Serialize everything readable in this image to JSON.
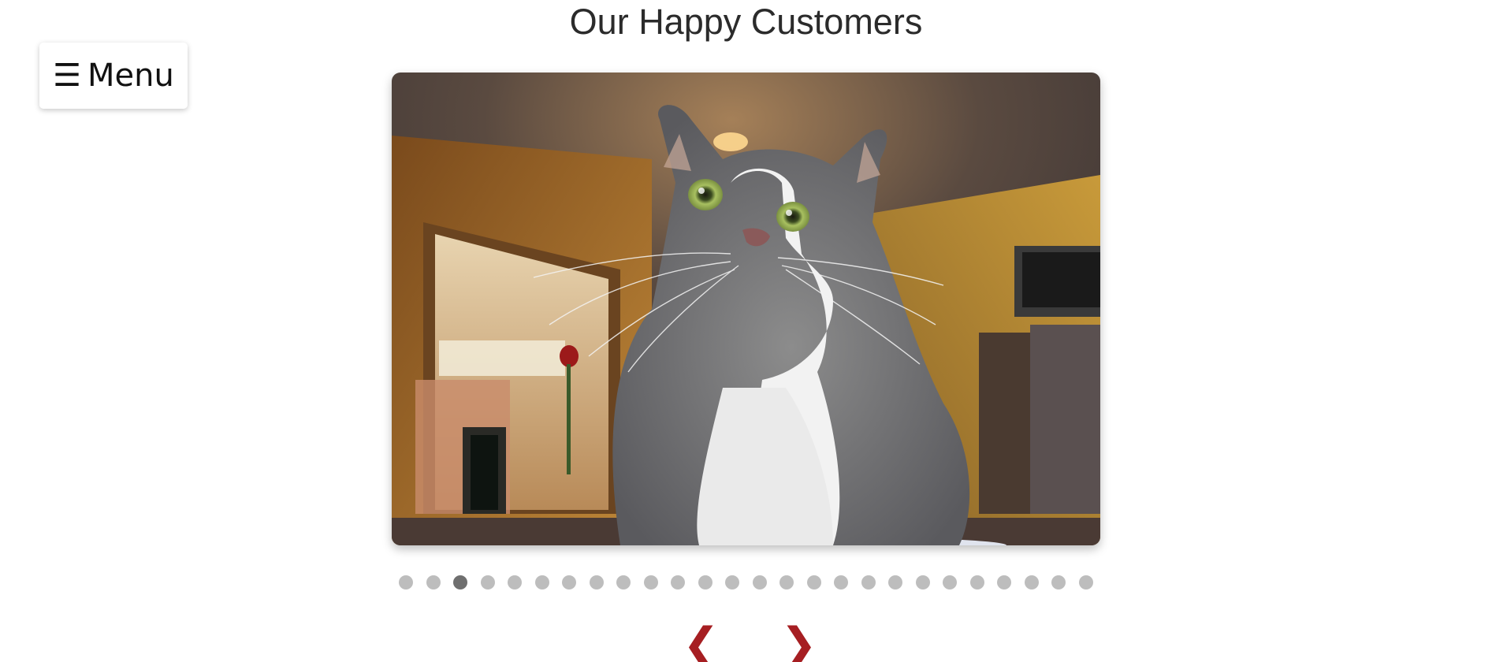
{
  "page": {
    "title": "Our Happy Customers"
  },
  "menu": {
    "icon": "hamburger-icon",
    "icon_glyph": "☰",
    "label": "Menu"
  },
  "carousel": {
    "slide_count": 26,
    "active_index": 2,
    "image_subject": "gray and white cat sitting indoors",
    "prev_glyph": "❮",
    "next_glyph": "❯",
    "prev_icon": "chevron-left-icon",
    "next_icon": "chevron-right-icon"
  },
  "colors": {
    "accent": "#a61e22",
    "dot_inactive": "#bdbdbd",
    "dot_active": "#6f6f6f",
    "title_text": "#2b2b2b"
  }
}
